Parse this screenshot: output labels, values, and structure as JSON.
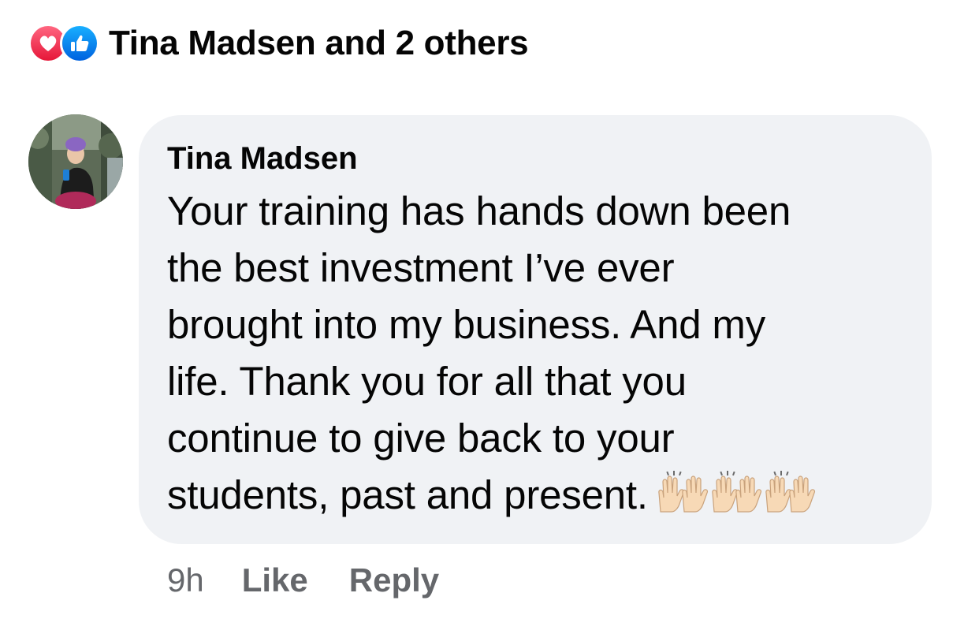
{
  "reactions": {
    "icons": [
      "love-reaction-icon",
      "like-reaction-icon"
    ],
    "summary": "Tina Madsen and 2 others",
    "colors": {
      "love": "#f33e58",
      "like": "#1877f2"
    }
  },
  "comment": {
    "author": "Tina Madsen",
    "text": "Your training has hands down been\nthe best investment I’ve ever\nbrought into my business. And my\nlife. Thank you for all that you\ncontinue to give back to your\nstudents, past and present.",
    "emoji": "🙌🙌🙌",
    "bubble_color": "#f0f2f5"
  },
  "actions": {
    "time": "9h",
    "like_label": "Like",
    "reply_label": "Reply",
    "muted_color": "#65676b"
  }
}
